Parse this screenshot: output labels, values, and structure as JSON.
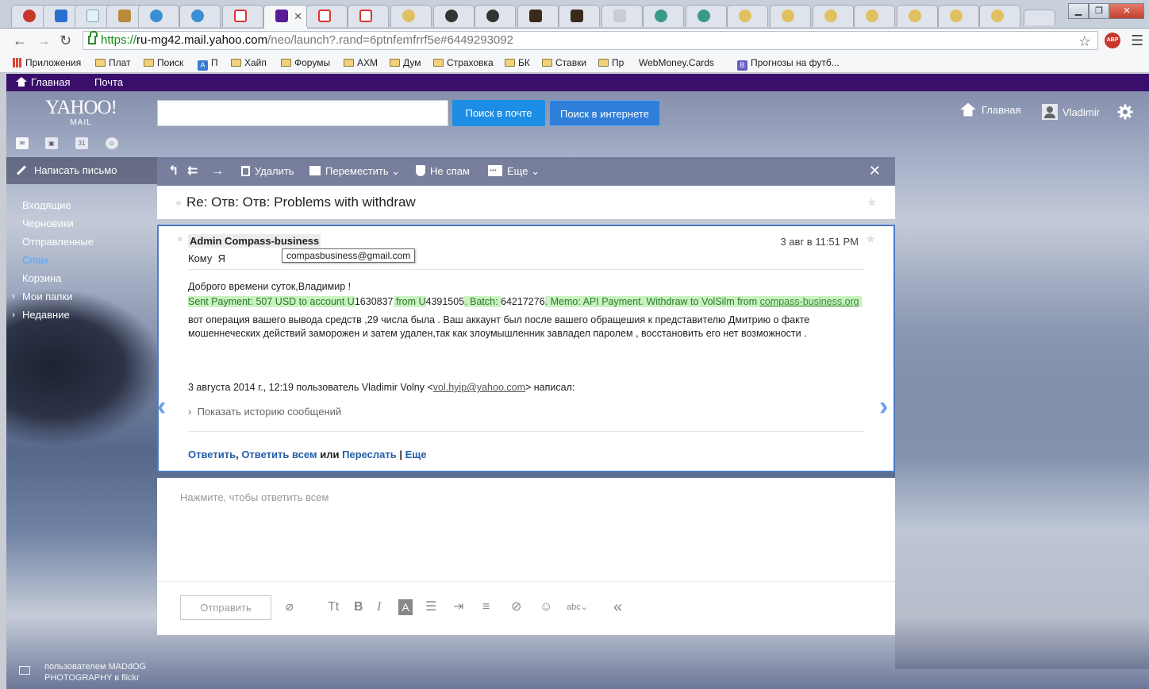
{
  "browser": {
    "url": {
      "scheme": "https://",
      "host": "ru-mg42.mail.yahoo.com",
      "rest": "/neo/launch?.rand=6ptnfemfrrf5e#6449293092"
    },
    "abp_label": "ABP",
    "bookmarks": [
      {
        "label": "Приложения",
        "icon": "apps-icon"
      },
      {
        "label": "Плат",
        "icon": "folder-icon"
      },
      {
        "label": "Поиск",
        "icon": "folder-icon"
      },
      {
        "label": "П",
        "icon": "translate-icon"
      },
      {
        "label": "Хайп",
        "icon": "folder-icon"
      },
      {
        "label": "Форумы",
        "icon": "folder-icon"
      },
      {
        "label": "АХМ",
        "icon": "folder-icon"
      },
      {
        "label": "Дум",
        "icon": "folder-icon"
      },
      {
        "label": "Страховка",
        "icon": "folder-icon"
      },
      {
        "label": "БК",
        "icon": "folder-icon"
      },
      {
        "label": "Ставки",
        "icon": "folder-icon"
      },
      {
        "label": "Пр",
        "icon": "folder-icon"
      },
      {
        "label": "WebMoney.Cards",
        "icon": "page-icon"
      },
      {
        "label": "Прогнозы на футб...",
        "icon": "vk-icon"
      }
    ]
  },
  "topnav": {
    "home": "Главная",
    "mail": "Почта"
  },
  "logo": {
    "yahoo": "YAHOO!",
    "mail": "MAIL"
  },
  "search": {
    "placeholder": "",
    "mail_btn": "Поиск в почте",
    "web_btn": "Поиск в интернете"
  },
  "header_right": {
    "home": "Главная",
    "user": "Vladimir"
  },
  "sidebar": {
    "compose": "Написать письмо",
    "folders": [
      {
        "label": "Входящие",
        "active": false
      },
      {
        "label": "Черновики",
        "active": false
      },
      {
        "label": "Отправленные",
        "active": false
      },
      {
        "label": "Спам",
        "active": true
      },
      {
        "label": "Корзина",
        "active": false
      },
      {
        "label": "Мои папки",
        "expandable": true
      },
      {
        "label": "Недавние",
        "expandable": true
      }
    ],
    "credit_line1": "пользователем MADdOG",
    "credit_line2": "PHOTOGRAPHY в flickr"
  },
  "toolbar": {
    "delete": "Удалить",
    "move": "Переместить",
    "notspam": "Не спам",
    "more": "Еще"
  },
  "message": {
    "subject": "Re: Отв: Отв: Problems with withdraw",
    "sender": "Admin Compass-business",
    "to_label": "Кому",
    "to_value": "Я",
    "email_tooltip": "compasbusiness@gmail.com",
    "date": "3 авг в 11:51 PM",
    "greeting": "Доброго времени суток,Владимир !",
    "payment": {
      "p1": "Sent Payment: 507  USD to account U",
      "n1": "1630837",
      "p2": " from U",
      "n2": "4391505",
      "p3": ". Batch: ",
      "n3": "64217276",
      "p4": ". Memo: API Payment. Withdraw to VolSilm from ",
      "link": "compass-business.org"
    },
    "body_line1": "вот операция вашего вывода средств ,29 числа была . Ваш аккаунт был после вашего обращешия к представителю Дмитрию о факте",
    "body_line2": "мошеннеческих действий заморожен и затем удален,так как злоумышленник завладел паролем , восстановить его нет возможности .",
    "quote_pre": "3 августа 2014 г., 12:19 пользователь Vladimir Volny <",
    "quote_email": "vol.hyip@yahoo.com",
    "quote_post": "> написал:",
    "history": "Показать историю сообщений",
    "reply": "Ответить",
    "reply_all": "Ответить всем",
    "or": "или",
    "forward": "Переслать",
    "more": "Еще"
  },
  "reply_box": {
    "placeholder": "Нажмите, чтобы ответить всем",
    "send": "Отправить"
  },
  "colors": {
    "brand_purple": "#3a0f6b",
    "accent_blue": "#1c8ee6",
    "active_folder": "#5aa8ff",
    "highlight_green": "#c9f2c0"
  }
}
